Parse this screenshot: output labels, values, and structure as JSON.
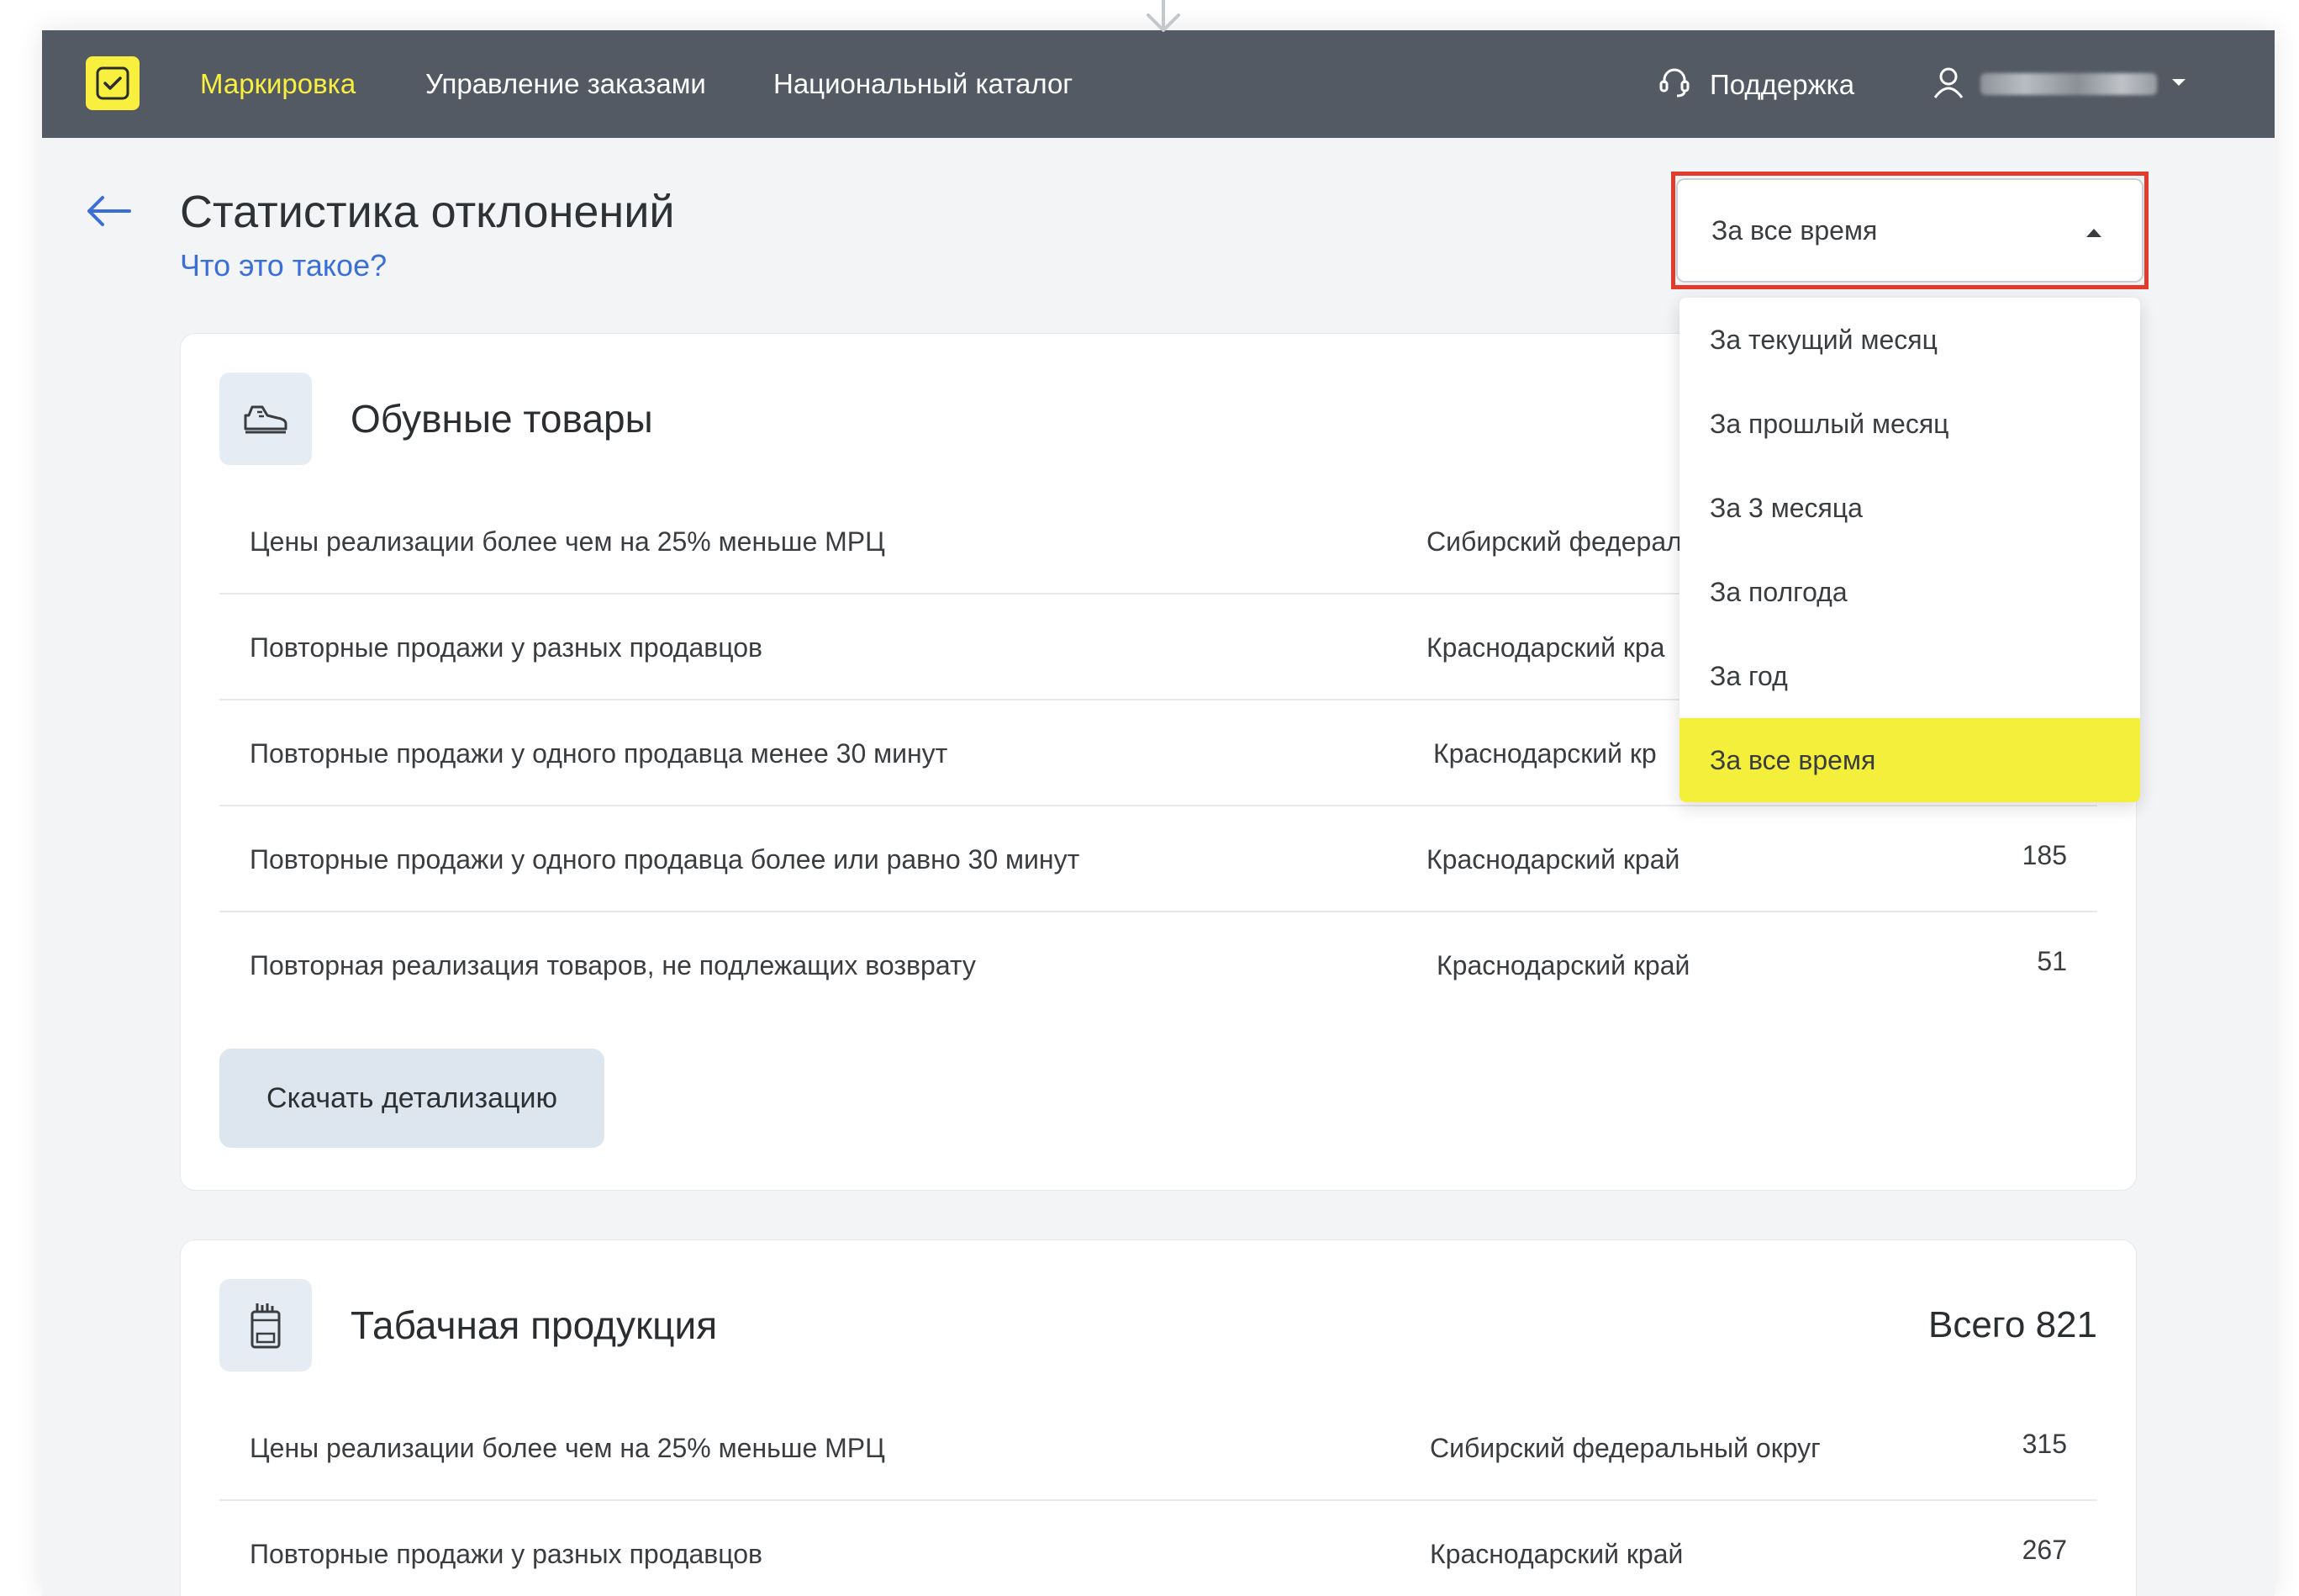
{
  "topbar": {
    "nav": [
      "Маркировка",
      "Управление заказами",
      "Национальный каталог"
    ],
    "support_label": "Поддержка"
  },
  "header": {
    "title": "Статистика отклонений",
    "help_link": "Что это такое?"
  },
  "period_select": {
    "value": "За все время",
    "options": [
      "За текущий месяц",
      "За прошлый месяц",
      "За 3 месяца",
      "За полгода",
      "За год",
      "За все время"
    ]
  },
  "sections": [
    {
      "title": "Обувные товары",
      "rows": [
        {
          "desc": "Цены реализации более чем на 25% меньше МРЦ",
          "region": "Сибирский федерал",
          "count": ""
        },
        {
          "desc": "Повторные продажи у разных продавцов",
          "region": "Краснодарский кра",
          "count": ""
        },
        {
          "desc": "Повторные продажи у одного продавца менее 30 минут",
          "region": "Краснодарский кр",
          "count": ""
        },
        {
          "desc": "Повторные продажи у одного продавца более или равно 30 минут",
          "region": "Краснодарский край",
          "count": "185"
        },
        {
          "desc": "Повторная реализация товаров, не подлежащих возврату",
          "region": "Краснодарский край",
          "count": "51"
        }
      ],
      "download_label": "Скачать детализацию"
    },
    {
      "title": "Табачная продукция",
      "total": "Всего 821",
      "rows": [
        {
          "desc": "Цены реализации более чем на 25% меньше МРЦ",
          "region": "Сибирский федеральный округ",
          "count": "315"
        },
        {
          "desc": "Повторные продажи у разных продавцов",
          "region": "Краснодарский край",
          "count": "267"
        }
      ]
    }
  ],
  "colors": {
    "topbar": "#535a63",
    "accent_yellow": "#f8ef3e",
    "highlight_red": "#e43c2c",
    "link_blue": "#3a6fd8"
  }
}
